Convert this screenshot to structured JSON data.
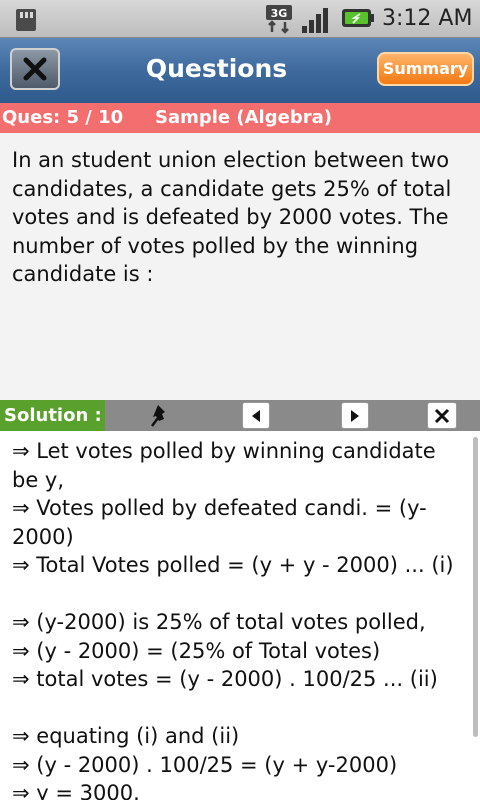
{
  "status_bar": {
    "time": "3:12 AM",
    "network_label": "3G",
    "icons": [
      "sd-card-icon",
      "network-3g-icon",
      "signal-icon",
      "battery-icon"
    ]
  },
  "header": {
    "title": "Questions",
    "summary_label": "Summary",
    "close_icon": "close-icon"
  },
  "question_bar": {
    "number": "Ques: 5 / 10",
    "category": "Sample (Algebra)"
  },
  "question": {
    "text": "In an student union election between two candidates, a candidate gets 25% of total votes and is defeated by 2000 votes. The number of votes polled by the winning candidate is :"
  },
  "solution_bar": {
    "label": "Solution :",
    "tools": [
      "pin-icon",
      "previous-arrow-icon",
      "next-arrow-icon",
      "close-icon"
    ]
  },
  "solution": {
    "lines": [
      "⇒ Let votes polled by winning candidate",
      "be y,",
      "⇒ Votes polled by defeated candi. = (y-",
      "2000)",
      "⇒ Total Votes polled = (y + y - 2000) ... (i)",
      "",
      "⇒ (y-2000) is 25% of total votes polled,",
      "⇒ (y - 2000) = (25% of Total votes)",
      "⇒ total votes = (y - 2000) . 100/25 ... (ii)",
      "",
      "⇒ equating (i) and (ii)",
      "⇒ (y - 2000) . 100/25 = (y + y-2000)",
      "⇒ y = 3000."
    ]
  },
  "colors": {
    "titlebar": "#3e6a9e",
    "summary_button": "#f27a13",
    "question_bar": "#f36f6f",
    "solution_label": "#5aa02c",
    "solution_toolbar": "#8a8a8a"
  }
}
